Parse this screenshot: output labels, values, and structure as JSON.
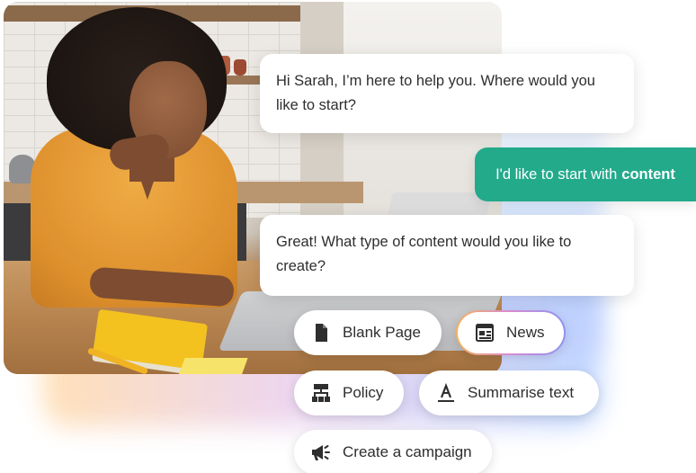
{
  "chat": {
    "bot_message_1": "Hi Sarah, I’m here to help you. Where would you like to start?",
    "user_message_prefix": "I'd like to start with",
    "user_message_emphasis": "content",
    "bot_message_2": "Great! What type of content would you like to create?"
  },
  "options": {
    "blank_page": {
      "label": "Blank Page",
      "icon": "document-icon"
    },
    "news": {
      "label": "News",
      "icon": "newspaper-icon"
    },
    "policy": {
      "label": "Policy",
      "icon": "hierarchy-icon"
    },
    "summarise": {
      "label": "Summarise text",
      "icon": "text-format-icon"
    },
    "campaign": {
      "label": "Create a campaign",
      "icon": "megaphone-icon"
    }
  },
  "colors": {
    "user_bubble": "#22aa8b",
    "chip_icon": "#2e2e2e"
  }
}
